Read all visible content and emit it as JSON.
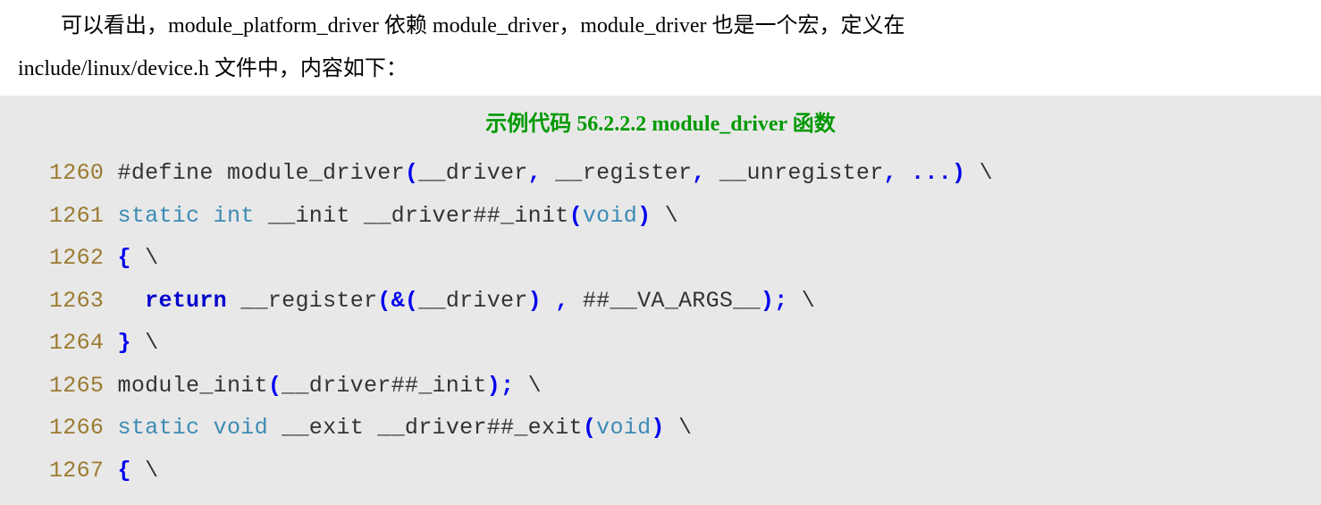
{
  "paragraph": {
    "line1": "可以看出，module_platform_driver 依赖 module_driver，module_driver 也是一个宏，定义在",
    "line2": "include/linux/device.h 文件中，内容如下："
  },
  "code": {
    "title": "示例代码 56.2.2.2 module_driver 函数",
    "lines": [
      {
        "num": "1260",
        "tokens": [
          {
            "cls": "normal",
            "text": " #define module_driver"
          },
          {
            "cls": "punct-blue",
            "text": "("
          },
          {
            "cls": "normal",
            "text": "__driver"
          },
          {
            "cls": "punct-blue",
            "text": ","
          },
          {
            "cls": "normal",
            "text": " __register"
          },
          {
            "cls": "punct-blue",
            "text": ","
          },
          {
            "cls": "normal",
            "text": " __unregister"
          },
          {
            "cls": "punct-blue",
            "text": ","
          },
          {
            "cls": "normal",
            "text": " "
          },
          {
            "cls": "punct-blue",
            "text": "...)"
          },
          {
            "cls": "normal",
            "text": " \\"
          }
        ]
      },
      {
        "num": "1261",
        "tokens": [
          {
            "cls": "normal",
            "text": " "
          },
          {
            "cls": "kw-type",
            "text": "static"
          },
          {
            "cls": "normal",
            "text": " "
          },
          {
            "cls": "kw-type",
            "text": "int"
          },
          {
            "cls": "normal",
            "text": " __init __driver##_init"
          },
          {
            "cls": "punct-blue",
            "text": "("
          },
          {
            "cls": "void-type",
            "text": "void"
          },
          {
            "cls": "punct-blue",
            "text": ")"
          },
          {
            "cls": "normal",
            "text": " \\"
          }
        ]
      },
      {
        "num": "1262",
        "tokens": [
          {
            "cls": "normal",
            "text": " "
          },
          {
            "cls": "punct-blue",
            "text": "{"
          },
          {
            "cls": "normal",
            "text": " \\"
          }
        ]
      },
      {
        "num": "1263",
        "tokens": [
          {
            "cls": "normal",
            "text": "   "
          },
          {
            "cls": "kw-return",
            "text": "return"
          },
          {
            "cls": "normal",
            "text": " __register"
          },
          {
            "cls": "punct-blue",
            "text": "(&("
          },
          {
            "cls": "normal",
            "text": "__driver"
          },
          {
            "cls": "punct-blue",
            "text": ")"
          },
          {
            "cls": "normal",
            "text": " "
          },
          {
            "cls": "punct-blue",
            "text": ","
          },
          {
            "cls": "normal",
            "text": " ##__VA_ARGS__"
          },
          {
            "cls": "punct-blue",
            "text": ");"
          },
          {
            "cls": "normal",
            "text": " \\"
          }
        ]
      },
      {
        "num": "1264",
        "tokens": [
          {
            "cls": "normal",
            "text": " "
          },
          {
            "cls": "punct-blue",
            "text": "}"
          },
          {
            "cls": "normal",
            "text": " \\"
          }
        ]
      },
      {
        "num": "1265",
        "tokens": [
          {
            "cls": "normal",
            "text": " module_init"
          },
          {
            "cls": "punct-blue",
            "text": "("
          },
          {
            "cls": "normal",
            "text": "__driver##_init"
          },
          {
            "cls": "punct-blue",
            "text": ");"
          },
          {
            "cls": "normal",
            "text": " \\"
          }
        ]
      },
      {
        "num": "1266",
        "tokens": [
          {
            "cls": "normal",
            "text": " "
          },
          {
            "cls": "kw-type",
            "text": "static"
          },
          {
            "cls": "normal",
            "text": " "
          },
          {
            "cls": "kw-type",
            "text": "void"
          },
          {
            "cls": "normal",
            "text": " __exit __driver##_exit"
          },
          {
            "cls": "punct-blue",
            "text": "("
          },
          {
            "cls": "void-type",
            "text": "void"
          },
          {
            "cls": "punct-blue",
            "text": ")"
          },
          {
            "cls": "normal",
            "text": " \\"
          }
        ]
      },
      {
        "num": "1267",
        "tokens": [
          {
            "cls": "normal",
            "text": " "
          },
          {
            "cls": "punct-blue",
            "text": "{"
          },
          {
            "cls": "normal",
            "text": " \\"
          }
        ]
      }
    ]
  }
}
